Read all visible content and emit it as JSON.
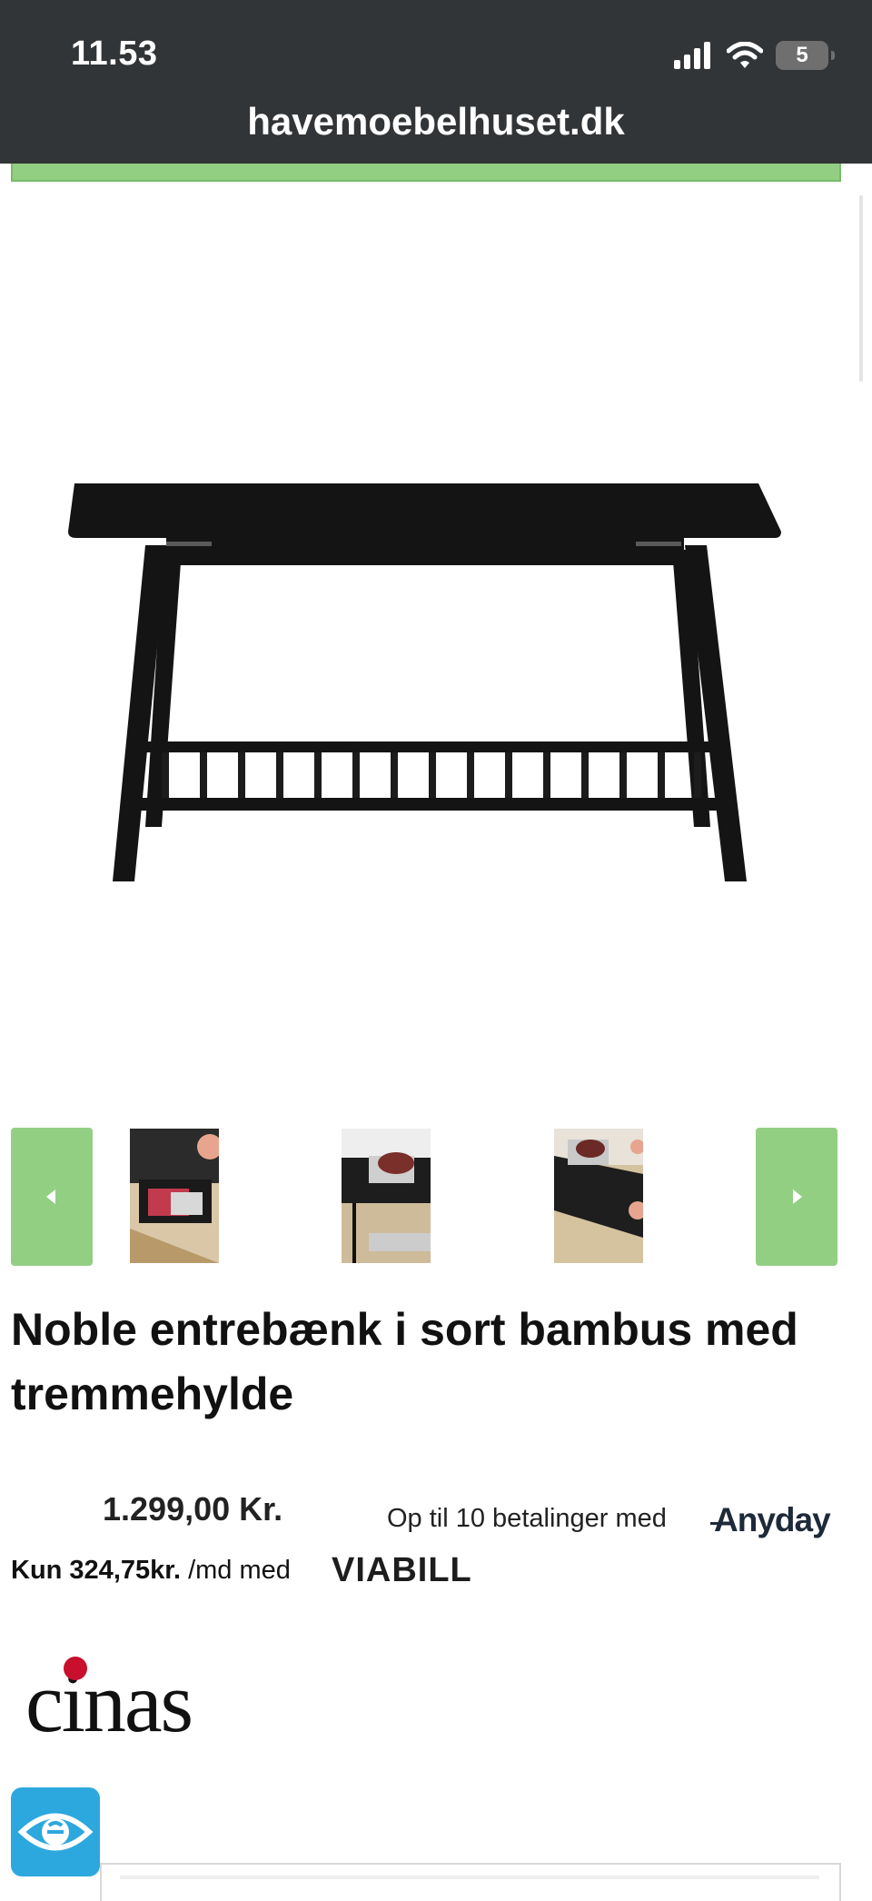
{
  "status_bar": {
    "time": "11.53",
    "battery": "5",
    "url": "havemoebelhuset.dk"
  },
  "product": {
    "image_icon": "black-bamboo-bench-image",
    "thumbnails": [
      {
        "icon": "bench-lifestyle-thumbnail-1"
      },
      {
        "icon": "bench-lifestyle-thumbnail-2"
      },
      {
        "icon": "bench-lifestyle-thumbnail-3"
      }
    ],
    "title": "Noble entrebænk i sort bambus med tremmehylde",
    "price": "1.299,00 Kr."
  },
  "payment": {
    "anyday_text": "Op til 10 betalinger med",
    "anyday_brand": "Anyday",
    "viabill_amount": "Kun 324,75kr.",
    "viabill_text": "/md med",
    "viabill_brand": "VIABILL"
  },
  "brand": {
    "logo_text": "cinas"
  },
  "colors": {
    "status_bar_bg": "#323537",
    "accent_green": "#92cf83",
    "eye_button": "#2da8de"
  }
}
